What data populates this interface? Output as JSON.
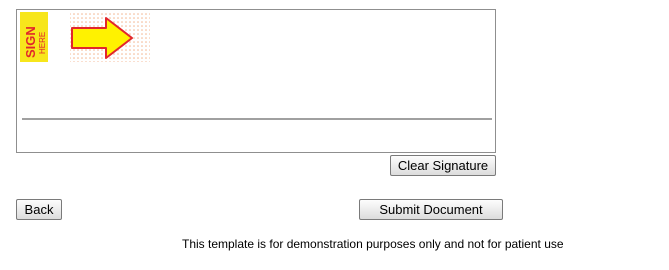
{
  "signature_pad": {
    "badge_text_line1": "SIGN",
    "badge_text_line2": "HERE",
    "badge_colors": {
      "background": "#f7e61c",
      "text": "#e2262b",
      "arrow_fill": "#fff200",
      "arrow_stroke": "#e2262b"
    }
  },
  "buttons": {
    "clear_label": "Clear Signature",
    "back_label": "Back",
    "submit_label": "Submit Document"
  },
  "footer": {
    "disclaimer": "This template is for demonstration purposes only and not for patient use"
  }
}
